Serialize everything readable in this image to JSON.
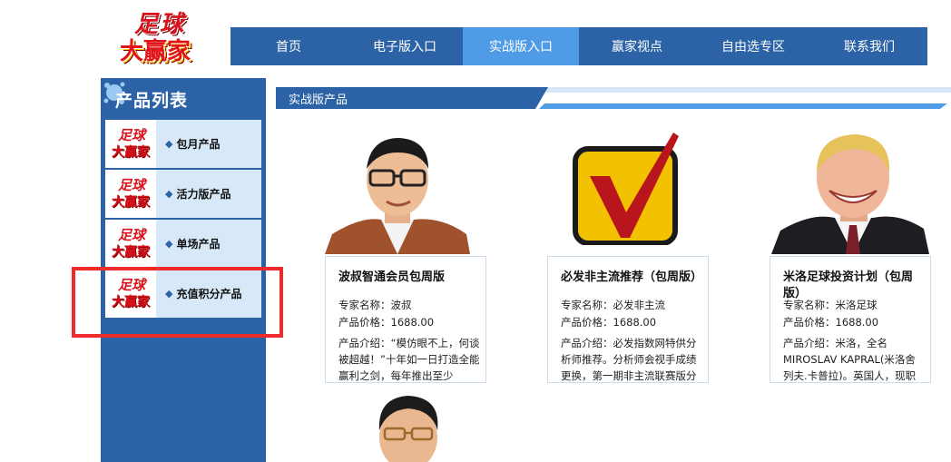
{
  "logo": {
    "line1": "足球",
    "line2": "大赢家"
  },
  "nav": {
    "items": [
      {
        "label": "首页"
      },
      {
        "label": "电子版入口"
      },
      {
        "label": "实战版入口"
      },
      {
        "label": "赢家视点"
      },
      {
        "label": "自由选专区"
      },
      {
        "label": "联系我们"
      }
    ],
    "active": "实战版入口"
  },
  "sidebar": {
    "title": "产品列表",
    "thumb_line1": "足球",
    "thumb_line2": "大赢家",
    "items": [
      {
        "label": "包月产品"
      },
      {
        "label": "活力版产品"
      },
      {
        "label": "单场产品"
      },
      {
        "label": "充值积分产品"
      }
    ]
  },
  "section": {
    "title": "实战版产品"
  },
  "products": [
    {
      "name": "波叔智通会员包周版",
      "expert": "专家名称：波叔",
      "price": "产品价格：1688.00",
      "intro": "产品介绍：“模仿眼不上，何谈被超越！”十年如一日打造全能赢利之剑，每年推出至少"
    },
    {
      "name": "必发非主流推荐（包周版）",
      "expert": "专家名称：必发非主流",
      "price": "产品价格：1688.00",
      "intro": "产品介绍：必发指数网特供分析师推荐。分析师会视手成绩更换，第一期非主流联赛版分"
    },
    {
      "name": "米洛足球投资计划（包周版）",
      "expert": "专家名称：米洛足球",
      "price": "产品价格：1688.00",
      "intro": "产品介绍：米洛，全名MIROSLAV KAPRAL(米洛舍列夫.卡普拉)。英国人，现职"
    }
  ],
  "colors": {
    "nav_bg": "#2b63a6",
    "nav_active": "#4f9be5",
    "sidebar_bg": "#2b63a6",
    "highlight_box": "#ee2a2a",
    "item_bg": "#d7e9f8"
  }
}
